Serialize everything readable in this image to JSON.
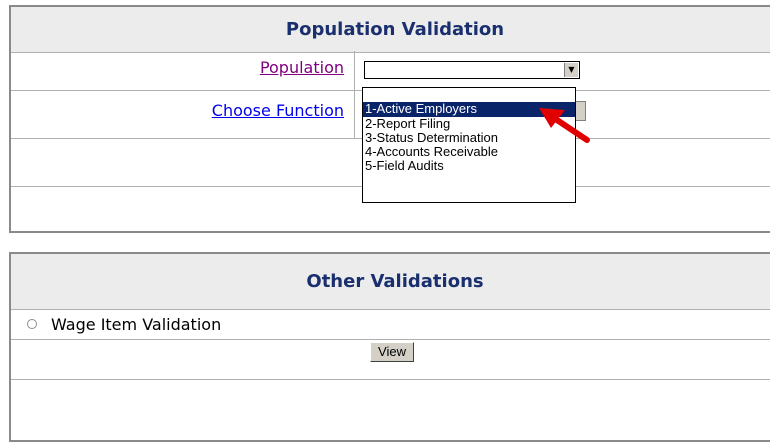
{
  "population_panel": {
    "title": "Population Validation",
    "population_label": "Population",
    "population_selected": "",
    "choose_function_label": "Choose Function",
    "dropdown_options": [
      "",
      "1-Active Employers",
      "2-Report Filing",
      "3-Status Determination",
      "4-Accounts Receivable",
      "5-Field Audits"
    ],
    "highlighted_index": 1
  },
  "other_panel": {
    "title": "Other Validations",
    "radio_label": "Wage Item Validation",
    "view_button": "View"
  },
  "colors": {
    "header_text": "#1a2f6e",
    "visited_link": "#800080",
    "link": "#0000ee",
    "selection": "#0a246a",
    "pointer_arrow": "#e00000"
  }
}
